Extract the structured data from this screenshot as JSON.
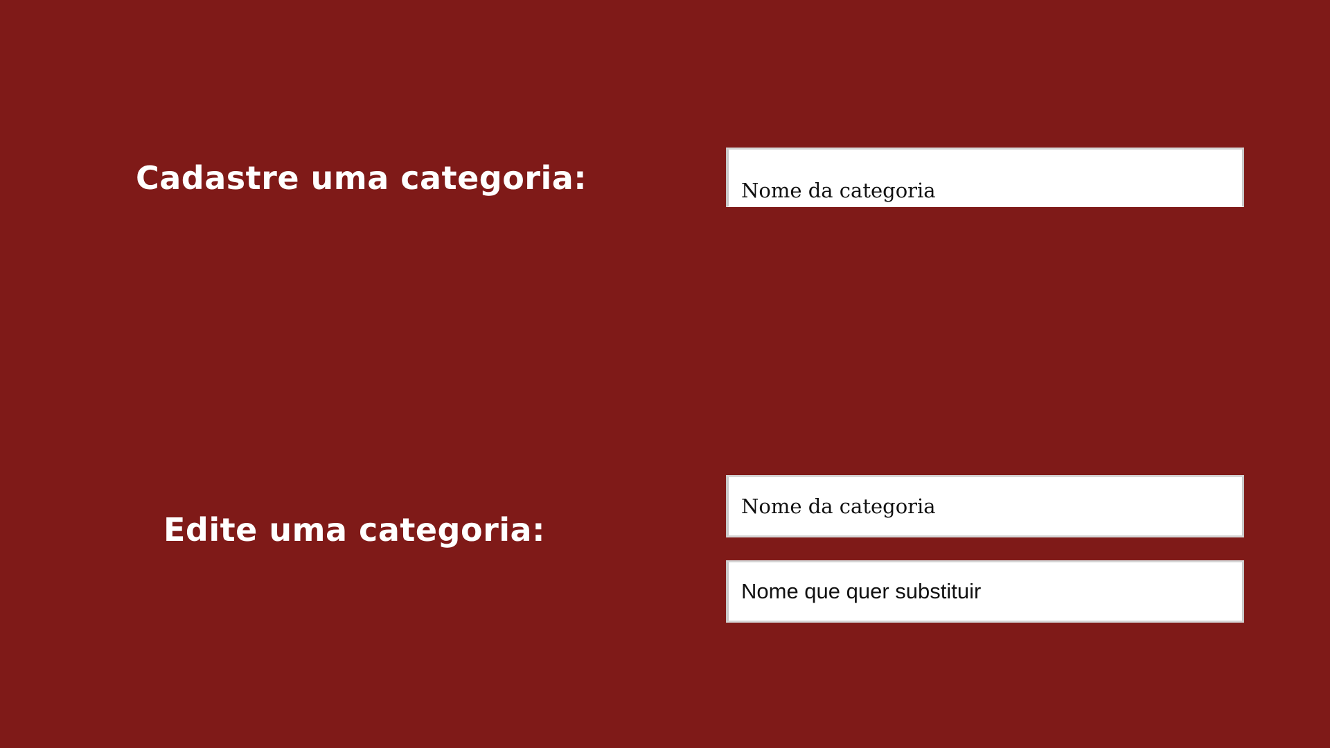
{
  "theme": {
    "background": "#7f1a18",
    "title_color": "#ffffff",
    "field_background": "#ffffff"
  },
  "create": {
    "title": "Cadastre uma categoria:",
    "name_field": {
      "placeholder": "Nome da categoria"
    }
  },
  "edit": {
    "title": "Edite uma categoria:",
    "name_field": {
      "placeholder": "Nome da categoria"
    },
    "replace_field": {
      "placeholder": "Nome que quer substituir"
    }
  }
}
